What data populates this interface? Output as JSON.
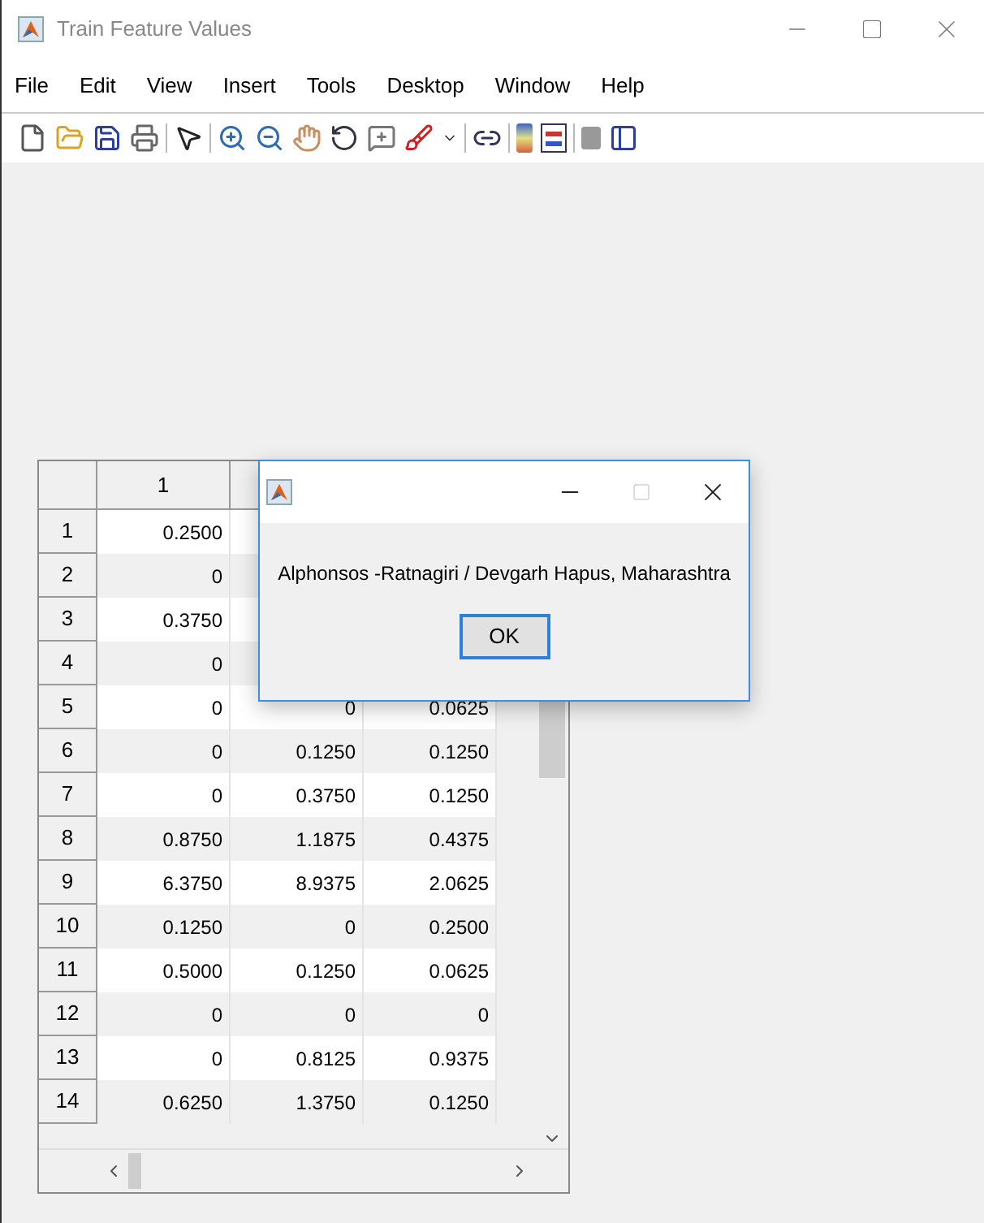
{
  "window": {
    "title": "Train Feature Values"
  },
  "menu": [
    "File",
    "Edit",
    "View",
    "Insert",
    "Tools",
    "Desktop",
    "Window",
    "Help"
  ],
  "table": {
    "columns": [
      "1"
    ],
    "rows": [
      {
        "header": "1",
        "cells": [
          "0.2500"
        ]
      },
      {
        "header": "2",
        "cells": [
          "0"
        ]
      },
      {
        "header": "3",
        "cells": [
          "0.3750"
        ]
      },
      {
        "header": "4",
        "cells": [
          "0"
        ]
      },
      {
        "header": "5",
        "cells": [
          "0",
          "0",
          "0.0625"
        ]
      },
      {
        "header": "6",
        "cells": [
          "0",
          "0.1250",
          "0.1250"
        ]
      },
      {
        "header": "7",
        "cells": [
          "0",
          "0.3750",
          "0.1250"
        ]
      },
      {
        "header": "8",
        "cells": [
          "0.8750",
          "1.1875",
          "0.4375"
        ]
      },
      {
        "header": "9",
        "cells": [
          "6.3750",
          "8.9375",
          "2.0625"
        ]
      },
      {
        "header": "10",
        "cells": [
          "0.1250",
          "0",
          "0.2500"
        ]
      },
      {
        "header": "11",
        "cells": [
          "0.5000",
          "0.1250",
          "0.0625"
        ]
      },
      {
        "header": "12",
        "cells": [
          "0",
          "0",
          "0"
        ]
      },
      {
        "header": "13",
        "cells": [
          "0",
          "0.8125",
          "0.9375"
        ]
      },
      {
        "header": "14",
        "cells": [
          "0.6250",
          "1.3750",
          "0.1250"
        ]
      }
    ]
  },
  "dialog": {
    "message": "Alphonsos -Ratnagiri / Devgarh Hapus, Maharashtra",
    "button": "OK"
  }
}
